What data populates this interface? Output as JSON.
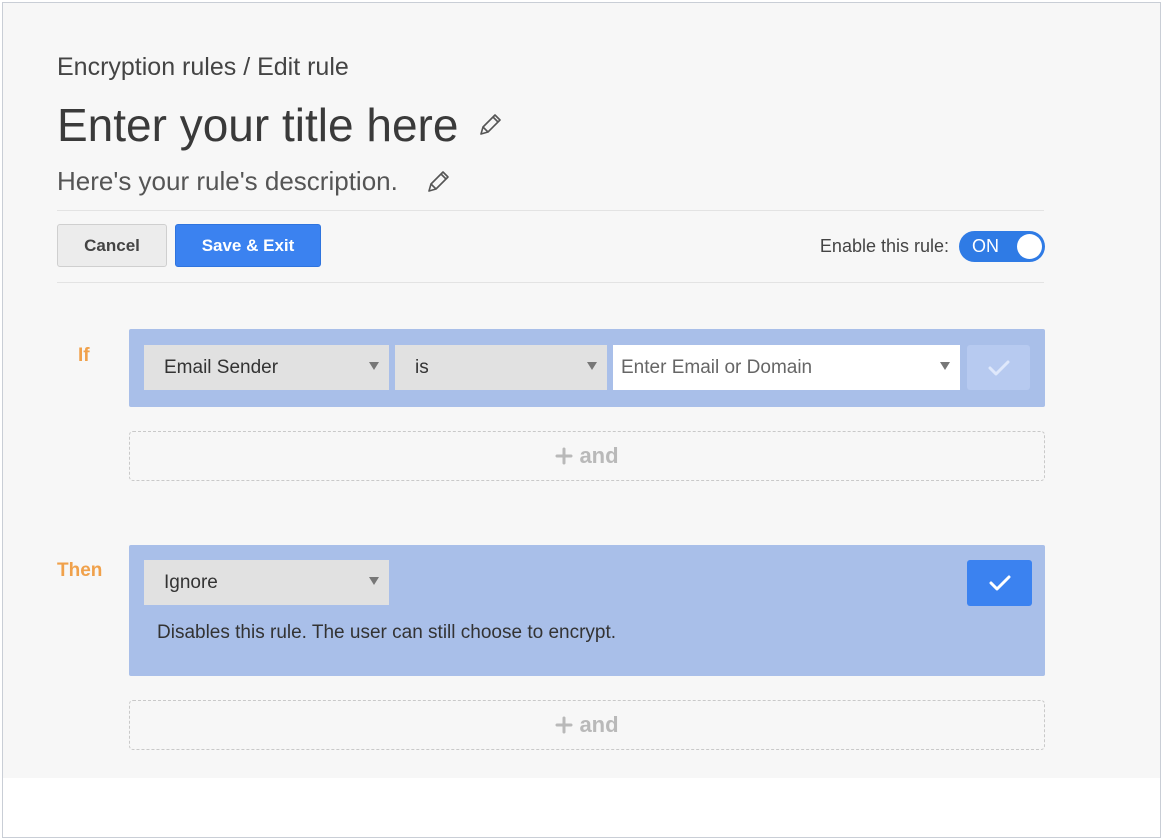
{
  "header": {
    "breadcrumb": "Encryption rules / Edit rule",
    "title": "Enter your title here",
    "description": "Here's your rule's description."
  },
  "toolbar": {
    "cancel_label": "Cancel",
    "save_label": "Save & Exit",
    "enable_label": "Enable this rule:",
    "toggle_state": "ON"
  },
  "if_section": {
    "label": "If",
    "field": "Email Sender",
    "operator": "is",
    "value_placeholder": "Enter Email or Domain",
    "add_label": "and"
  },
  "then_section": {
    "label": "Then",
    "action": "Ignore",
    "action_description": "Disables this rule. The user can still choose to encrypt.",
    "add_label": "and"
  },
  "icons": {
    "edit": "pencil-icon",
    "confirm": "check-icon",
    "dropdown": "chevron-down-icon",
    "add": "plus-icon"
  },
  "colors": {
    "accent": "#3b82f0",
    "block": "#a9bfe9",
    "section_label": "#f0a14b"
  }
}
